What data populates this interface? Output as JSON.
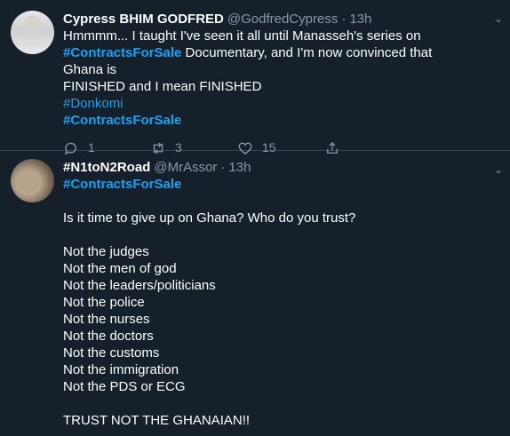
{
  "tweets": [
    {
      "name": "Cypress BHIM GODFRED",
      "handle": "@GodfredCypress",
      "time": "13h",
      "line1": "Hmmmm... I taught I've seen it all until Manasseh's series on",
      "hashtag_contracts": "#ContractsForSale",
      "line2_rest": " Documentary, and I'm now convinced that Ghana is",
      "line3": "FINISHED and I mean FINISHED",
      "hashtag_donkomi": "#Donkomi",
      "replies": "1",
      "retweets": "3",
      "likes": "15"
    },
    {
      "name": "#N1toN2Road",
      "handle": "@MrAssor",
      "time": "13h",
      "hashtag_contracts": "#ContractsForSale",
      "question": "Is it time to give up on Ghana? Who do you trust?",
      "list": [
        "Not the judges",
        "Not the men of god",
        "Not the leaders/politicians",
        "Not the police",
        "Not the nurses",
        "Not the doctors",
        "Not the customs",
        "Not the immigration",
        "Not the PDS or ECG"
      ],
      "closing": "TRUST NOT THE GHANAIAN!!"
    }
  ],
  "colors": {
    "background": "#15202b",
    "accent": "#1da1f2",
    "muted": "#8899a6"
  },
  "icons": [
    "reply-icon",
    "retweet-icon",
    "like-icon",
    "share-icon",
    "chevron-down-icon"
  ]
}
